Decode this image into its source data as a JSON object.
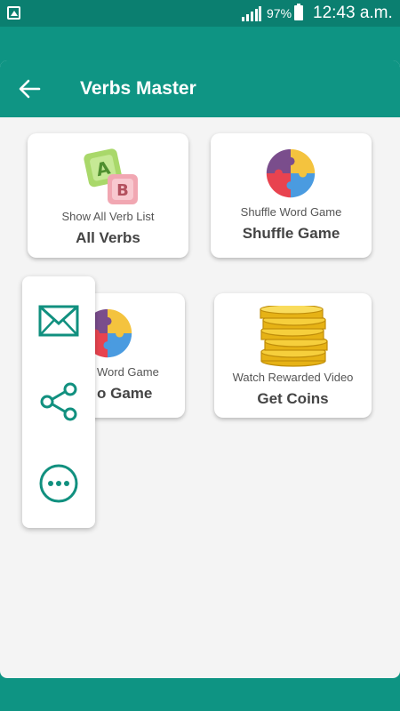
{
  "statusbar": {
    "battery": "97%",
    "time": "12:43 a.m."
  },
  "appbar": {
    "title": "Verbs Master"
  },
  "cards": [
    {
      "subtitle": "Show All Verb List",
      "title": "All Verbs",
      "icon": "abc-blocks-icon"
    },
    {
      "subtitle": "Shuffle Word Game",
      "title": "Shuffle Game",
      "icon": "puzzle-icon"
    },
    {
      "subtitle": "Word Game",
      "title": "o Game",
      "icon": "puzzle-icon"
    },
    {
      "subtitle": "Watch Rewarded Video",
      "title": "Get Coins",
      "icon": "coins-icon"
    }
  ],
  "side_panel": {
    "items": [
      "mail-icon",
      "share-icon",
      "more-icon"
    ]
  },
  "colors": {
    "primary": "#0f9584",
    "statusbar": "#0b7f70",
    "background": "#f4f4f4",
    "icon_teal": "#11907f"
  }
}
